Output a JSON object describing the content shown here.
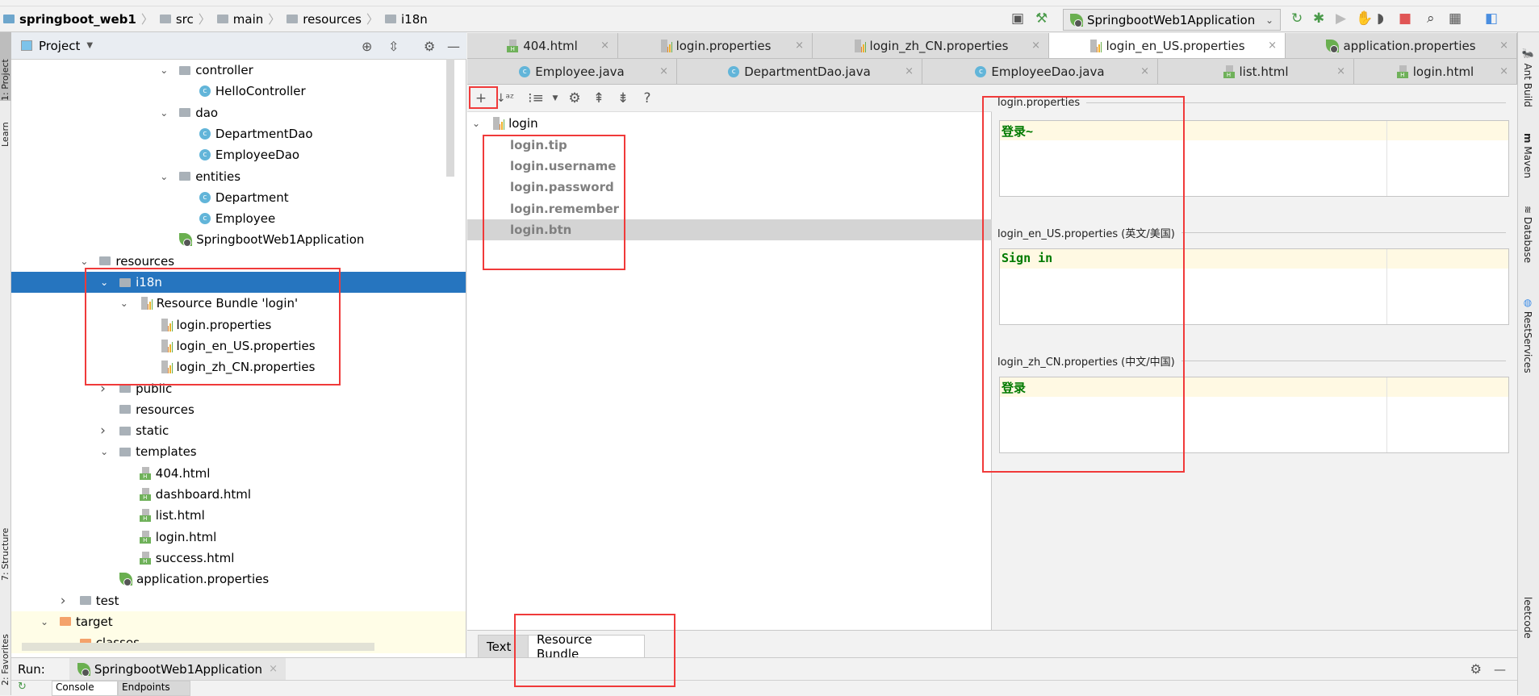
{
  "breadcrumb": [
    "springboot_web1",
    "src",
    "main",
    "resources",
    "i18n"
  ],
  "run_config": {
    "label": "SpringbootWeb1Application"
  },
  "colors": {
    "selection": "#2675bf",
    "key_text": "#808080",
    "value_text": "#007a00",
    "highlight_box": "#f03a3a",
    "excluded_bg": "#fffde7"
  },
  "left_strip": {
    "project": "1: Project",
    "learn": "Learn",
    "structure": "7: Structure",
    "favorites": "2: Favorites"
  },
  "project_panel": {
    "title": "Project",
    "tree": [
      {
        "label": "controller",
        "level": 6,
        "icon": "folder",
        "expanded": true
      },
      {
        "label": "HelloController",
        "level": 7,
        "icon": "class"
      },
      {
        "label": "dao",
        "level": 6,
        "icon": "folder",
        "expanded": true
      },
      {
        "label": "DepartmentDao",
        "level": 7,
        "icon": "class"
      },
      {
        "label": "EmployeeDao",
        "level": 7,
        "icon": "class"
      },
      {
        "label": "entities",
        "level": 6,
        "icon": "folder",
        "expanded": true
      },
      {
        "label": "Department",
        "level": 7,
        "icon": "class"
      },
      {
        "label": "Employee",
        "level": 7,
        "icon": "class"
      },
      {
        "label": "SpringbootWeb1Application",
        "level": 6,
        "icon": "spring"
      },
      {
        "label": "resources",
        "level": 2,
        "icon": "folder",
        "expanded": true
      },
      {
        "label": "i18n",
        "level": 3,
        "icon": "folder",
        "expanded": true,
        "selected": true
      },
      {
        "label": "Resource Bundle 'login'",
        "level": 4,
        "icon": "bundle",
        "expanded": true
      },
      {
        "label": "login.properties",
        "level": 5,
        "icon": "props"
      },
      {
        "label": "login_en_US.properties",
        "level": 5,
        "icon": "props"
      },
      {
        "label": "login_zh_CN.properties",
        "level": 5,
        "icon": "props"
      },
      {
        "label": "public",
        "level": 3,
        "icon": "folder",
        "expanded": false
      },
      {
        "label": "resources",
        "level": 3,
        "icon": "folder"
      },
      {
        "label": "static",
        "level": 3,
        "icon": "folder",
        "expanded": false
      },
      {
        "label": "templates",
        "level": 3,
        "icon": "folder",
        "expanded": true
      },
      {
        "label": "404.html",
        "level": 4,
        "icon": "html"
      },
      {
        "label": "dashboard.html",
        "level": 4,
        "icon": "html"
      },
      {
        "label": "list.html",
        "level": 4,
        "icon": "html"
      },
      {
        "label": "login.html",
        "level": 4,
        "icon": "html"
      },
      {
        "label": "success.html",
        "level": 4,
        "icon": "html"
      },
      {
        "label": "application.properties",
        "level": 3,
        "icon": "spring"
      },
      {
        "label": "test",
        "level": 1,
        "icon": "folder",
        "expanded": false
      },
      {
        "label": "target",
        "level": 0,
        "icon": "folder-orange",
        "expanded": true,
        "excluded": true
      },
      {
        "label": "classes",
        "level": 1,
        "icon": "folder-orange",
        "expanded": true,
        "excluded": true
      }
    ]
  },
  "editor_tabs_row1": [
    {
      "label": "404.html",
      "icon": "html"
    },
    {
      "label": "login.properties",
      "icon": "props"
    },
    {
      "label": "login_zh_CN.properties",
      "icon": "props"
    },
    {
      "label": "login_en_US.properties",
      "icon": "props",
      "active": true
    },
    {
      "label": "application.properties",
      "icon": "spring"
    }
  ],
  "editor_tabs_row2": [
    {
      "label": "Employee.java",
      "icon": "class"
    },
    {
      "label": "DepartmentDao.java",
      "icon": "class"
    },
    {
      "label": "EmployeeDao.java",
      "icon": "class"
    },
    {
      "label": "list.html",
      "icon": "html"
    },
    {
      "label": "login.html",
      "icon": "html"
    }
  ],
  "bundle_tree": {
    "root": "login",
    "keys": [
      "login.tip",
      "login.username",
      "login.password",
      "login.remember",
      "login.btn"
    ],
    "selected_key": "login.btn"
  },
  "values_panel": [
    {
      "file": "login.properties",
      "value": "登录~"
    },
    {
      "file": "login_en_US.properties (英文/美国)",
      "value": "Sign in"
    },
    {
      "file": "login_zh_CN.properties (中文/中国)",
      "value": "登录"
    }
  ],
  "bottom_tabs": [
    {
      "label": "Text"
    },
    {
      "label": "Resource Bundle",
      "active": true
    }
  ],
  "right_strip": [
    "Ant Build",
    "Maven",
    "Database",
    "RestServices",
    "leetcode"
  ],
  "run_bar": {
    "label": "Run:",
    "config": "SpringbootWeb1Application",
    "tabs": [
      "Console",
      "Endpoints"
    ]
  }
}
